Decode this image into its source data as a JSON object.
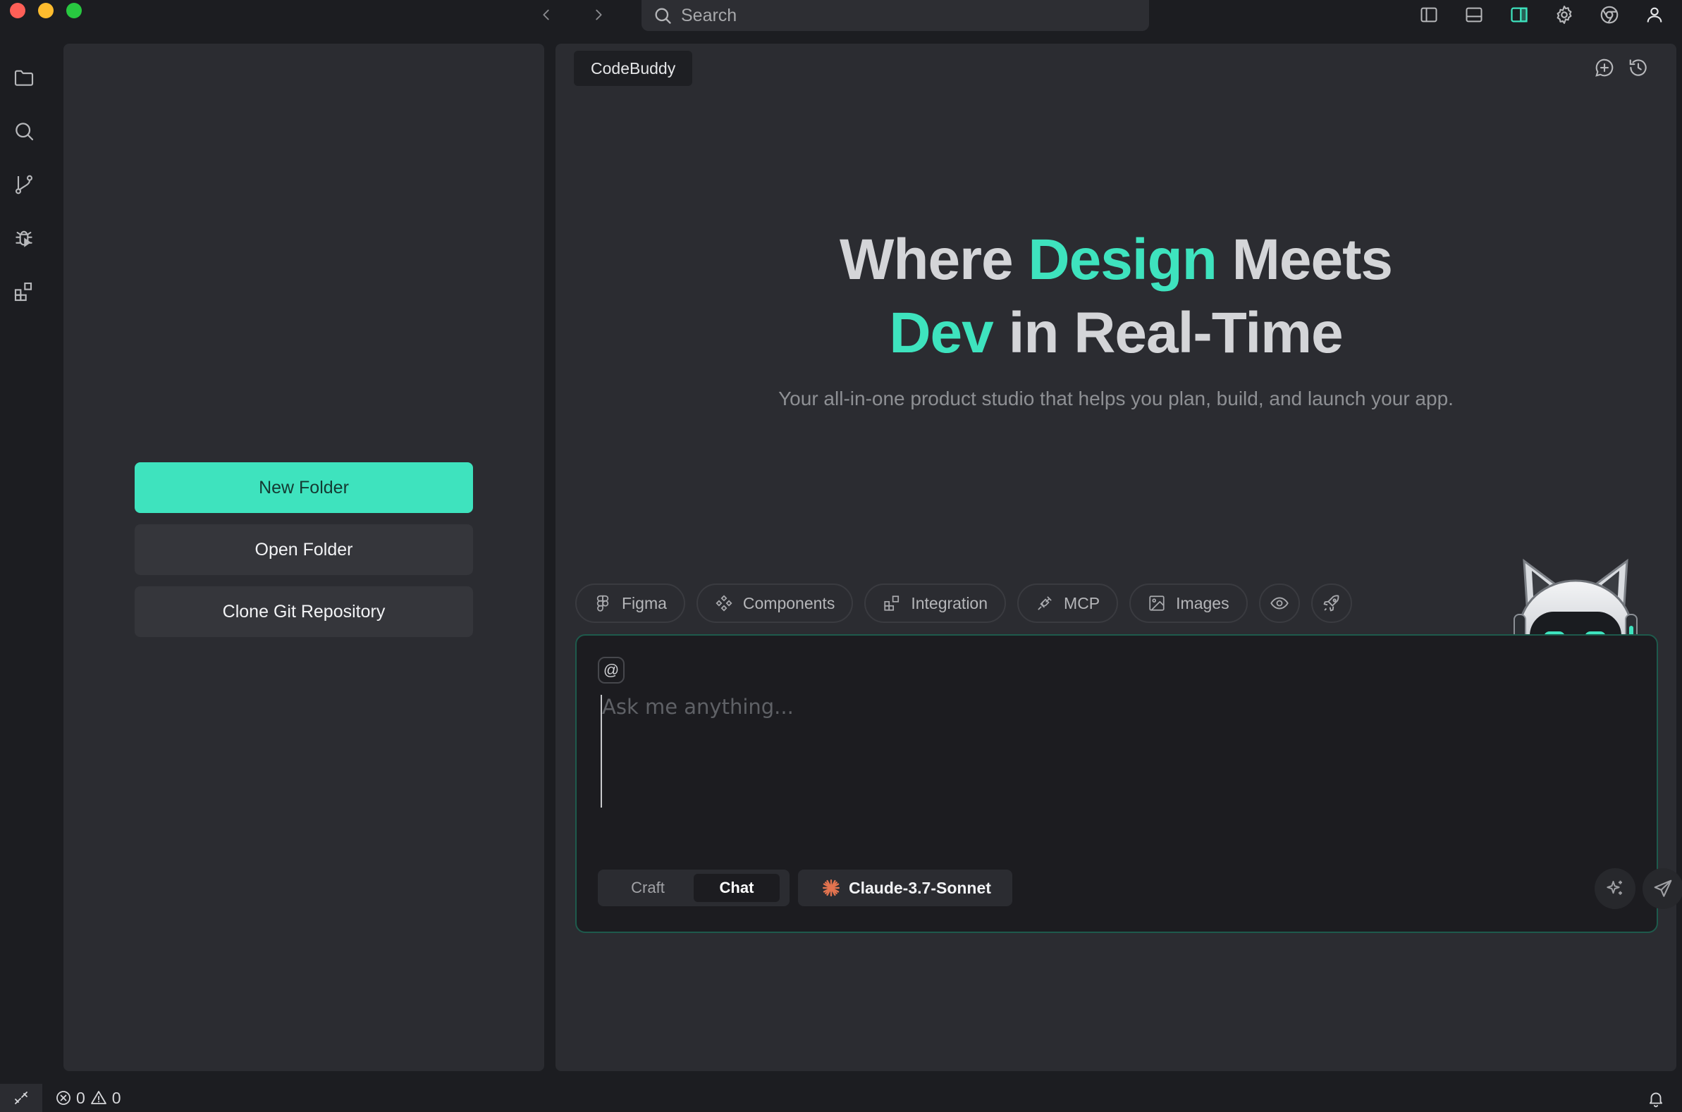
{
  "titlebar": {
    "search_placeholder": "Search"
  },
  "explorer": {
    "new_folder_label": "New Folder",
    "open_folder_label": "Open Folder",
    "clone_repo_label": "Clone Git Repository"
  },
  "chat": {
    "tab_label": "CodeBuddy",
    "hero_word1": "Where ",
    "hero_accent1": "Design",
    "hero_word2": " Meets",
    "hero_accent2": "Dev",
    "hero_word3": " in Real-Time",
    "subtitle": "Your all-in-one product studio that helps you plan, build, and launch your app.",
    "chips": {
      "figma": "Figma",
      "components": "Components",
      "integration": "Integration",
      "mcp": "MCP",
      "images": "Images"
    },
    "at_symbol": "@",
    "input_placeholder": "Ask me anything...",
    "mode_craft": "Craft",
    "mode_chat": "Chat",
    "selected_mode": "Chat",
    "model_name": "Claude-3.7-Sonnet"
  },
  "statusbar": {
    "error_count": "0",
    "warning_count": "0"
  },
  "colors": {
    "accent": "#3ee3be",
    "background": "#1c1d21",
    "panel": "#2b2c31",
    "claude_orange": "#e2734f"
  },
  "icons": {
    "activity_bar": [
      "folder-icon",
      "search-icon",
      "source-control-icon",
      "debug-icon",
      "extensions-icon"
    ],
    "top_right": [
      "toggle-primary-sidebar-icon",
      "toggle-panel-icon",
      "toggle-secondary-sidebar-icon",
      "settings-gear-icon",
      "browser-icon",
      "account-icon"
    ]
  }
}
